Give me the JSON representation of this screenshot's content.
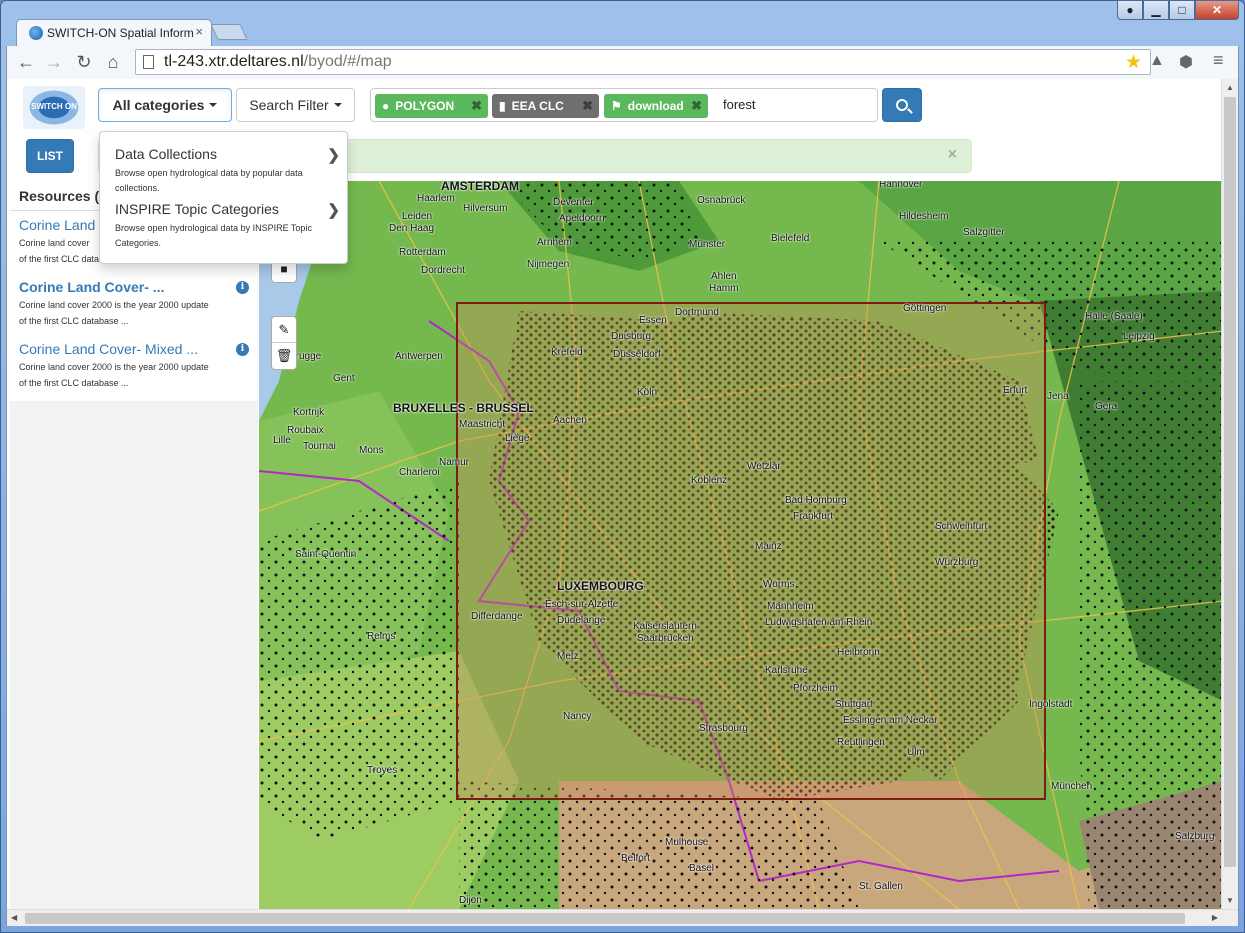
{
  "browser": {
    "tab_title": "SWITCH-ON Spatial Inform",
    "tab_close": "×",
    "url_host": "tl-243.xtr.deltares.nl",
    "url_path": "/byod/#/map",
    "window_buttons": [
      "user-icon",
      "minimize-icon",
      "maximize-icon",
      "close-icon"
    ]
  },
  "app": {
    "logo_text": "SWITCH ON",
    "categories_button": "All categories",
    "search_filter_button": "Search Filter",
    "tags": [
      {
        "label": "POLYGON",
        "icon": "globe-icon",
        "color": "#5cb85c"
      },
      {
        "label": "EEA CLC",
        "icon": "bookmark-icon",
        "color": "#6f6f6f"
      },
      {
        "label": "download",
        "icon": "flag-icon",
        "color": "#5cb85c"
      }
    ],
    "search_text": "forest",
    "list_button": "LIST",
    "alert_close": "×"
  },
  "dropdown": {
    "items": [
      {
        "title": "Data Collections",
        "desc": "Browse open hydrological data by popular data collections."
      },
      {
        "title": "INSPIRE Topic Categories",
        "desc": "Browse open hydrological data by INSPIRE Topic Categories."
      }
    ]
  },
  "sidebar": {
    "title": "Resources (",
    "results": [
      {
        "title": "Corine Land",
        "desc1": "Corine land cover",
        "desc2": "of the first CLC database ..."
      },
      {
        "title": "Corine Land Cover- ...",
        "desc1": "Corine land cover 2000 is the year 2000 update",
        "desc2": "of the first CLC database ..."
      },
      {
        "title": "Corine Land Cover- Mixed ...",
        "desc1": "Corine land cover 2000 is the year 2000 update",
        "desc2": "of the first CLC database ..."
      }
    ]
  },
  "map": {
    "labels": [
      {
        "text": "AMSTERDAM",
        "big": true
      },
      {
        "text": "Haarlem"
      },
      {
        "text": "Hilversum"
      },
      {
        "text": "Leiden"
      },
      {
        "text": "Den Haag"
      },
      {
        "text": "Rotterdam"
      },
      {
        "text": "Dordrecht"
      },
      {
        "text": "Nijmegen"
      },
      {
        "text": "Arnhem"
      },
      {
        "text": "Apeldoorn"
      },
      {
        "text": "Deventer"
      },
      {
        "text": "Osnabrück"
      },
      {
        "text": "Bielefeld"
      },
      {
        "text": "Hannover"
      },
      {
        "text": "Hildesheim"
      },
      {
        "text": "Salzgitter"
      },
      {
        "text": "Münster"
      },
      {
        "text": "Ahlen"
      },
      {
        "text": "Hamm"
      },
      {
        "text": "Dortmund"
      },
      {
        "text": "Essen"
      },
      {
        "text": "Duisburg"
      },
      {
        "text": "Düsseldorf"
      },
      {
        "text": "Krefeld"
      },
      {
        "text": "Köln"
      },
      {
        "text": "Göttingen"
      },
      {
        "text": "Halle (Saale)"
      },
      {
        "text": "Leipzig"
      },
      {
        "text": "Erfurt"
      },
      {
        "text": "Jena"
      },
      {
        "text": "Gera"
      },
      {
        "text": "BRUXELLES - BRUSSEL",
        "big": true
      },
      {
        "text": "Brugge"
      },
      {
        "text": "Gent"
      },
      {
        "text": "Antwerpen"
      },
      {
        "text": "Kortrijk"
      },
      {
        "text": "Roubaix"
      },
      {
        "text": "Lille"
      },
      {
        "text": "Tournai"
      },
      {
        "text": "Mons"
      },
      {
        "text": "Charleroi"
      },
      {
        "text": "Namur"
      },
      {
        "text": "Liège"
      },
      {
        "text": "Maastricht"
      },
      {
        "text": "Aachen"
      },
      {
        "text": "Koblenz"
      },
      {
        "text": "Bad Homburg"
      },
      {
        "text": "Frankfurt"
      },
      {
        "text": "Mainz"
      },
      {
        "text": "Wetzlar"
      },
      {
        "text": "Schweinfurt"
      },
      {
        "text": "Würzburg"
      },
      {
        "text": "LUXEMBOURG",
        "big": true
      },
      {
        "text": "Esch-sur-Alzette"
      },
      {
        "text": "Dudelange"
      },
      {
        "text": "Differdange"
      },
      {
        "text": "Kaiserslautern"
      },
      {
        "text": "Saarbrücken"
      },
      {
        "text": "Metz"
      },
      {
        "text": "Nancy"
      },
      {
        "text": "Reims"
      },
      {
        "text": "Troyes"
      },
      {
        "text": "Saint-Quentin"
      },
      {
        "text": "Worms"
      },
      {
        "text": "Mannheim"
      },
      {
        "text": "Ludwigshafen am Rhein"
      },
      {
        "text": "Heilbronn"
      },
      {
        "text": "Karlsruhe"
      },
      {
        "text": "Pforzheim"
      },
      {
        "text": "Stuttgart"
      },
      {
        "text": "Esslingen am Neckar"
      },
      {
        "text": "Reutlingen"
      },
      {
        "text": "Ulm"
      },
      {
        "text": "Strasbourg"
      },
      {
        "text": "Mulhouse"
      },
      {
        "text": "Belfort"
      },
      {
        "text": "Basel"
      },
      {
        "text": "Dijon"
      },
      {
        "text": "St. Gallen"
      },
      {
        "text": "München"
      },
      {
        "text": "Ingolstadt"
      },
      {
        "text": "Salzburg"
      }
    ]
  },
  "colors": {
    "primary": "#337ab7",
    "success": "#5cb85c",
    "alert_bg": "#dff0d8",
    "bbox": "#7a1e12"
  }
}
